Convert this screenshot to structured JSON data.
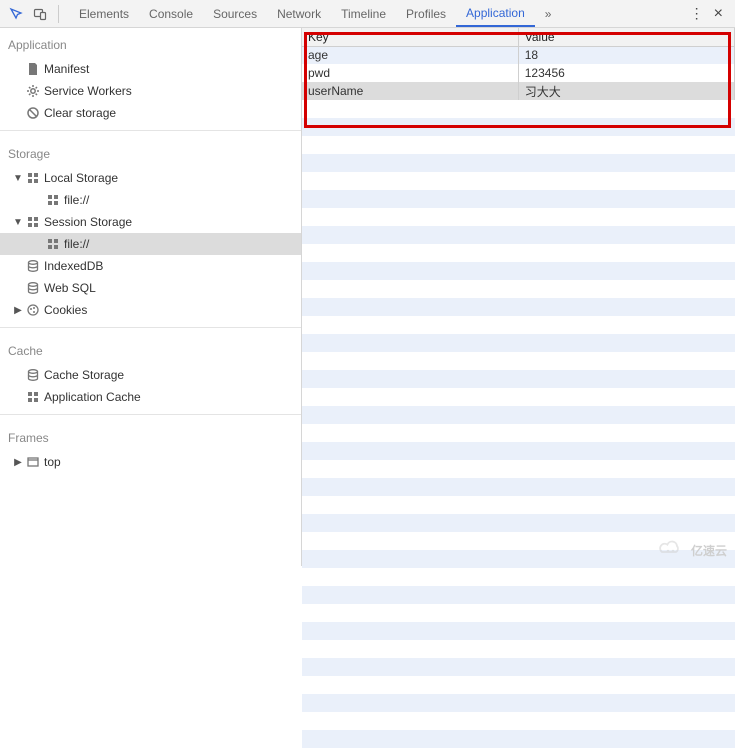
{
  "topbar": {
    "tabs": [
      "Elements",
      "Console",
      "Sources",
      "Network",
      "Timeline",
      "Profiles",
      "Application"
    ],
    "active_tab": "Application",
    "more": "»",
    "menu": "⋮",
    "close": "×"
  },
  "sidebar": {
    "groups": [
      {
        "title": "Application",
        "items": [
          {
            "icon": "manifest-icon",
            "label": "Manifest",
            "level": 1
          },
          {
            "icon": "gear-icon",
            "label": "Service Workers",
            "level": 1
          },
          {
            "icon": "clear-icon",
            "label": "Clear storage",
            "level": 1
          }
        ]
      },
      {
        "title": "Storage",
        "items": [
          {
            "arrow": "▼",
            "icon": "grid-icon",
            "label": "Local Storage",
            "level": 1
          },
          {
            "icon": "grid-icon",
            "label": "file://",
            "level": 2
          },
          {
            "arrow": "▼",
            "icon": "grid-icon",
            "label": "Session Storage",
            "level": 1
          },
          {
            "icon": "grid-icon",
            "label": "file://",
            "level": 2,
            "selected": true
          },
          {
            "icon": "db-icon",
            "label": "IndexedDB",
            "level": 1
          },
          {
            "icon": "db-icon",
            "label": "Web SQL",
            "level": 1
          },
          {
            "arrow": "▶",
            "icon": "cookie-icon",
            "label": "Cookies",
            "level": 1
          }
        ]
      },
      {
        "title": "Cache",
        "items": [
          {
            "icon": "db-icon",
            "label": "Cache Storage",
            "level": 1
          },
          {
            "icon": "grid-icon",
            "label": "Application Cache",
            "level": 1
          }
        ]
      },
      {
        "title": "Frames",
        "items": [
          {
            "arrow": "▶",
            "icon": "frame-icon",
            "label": "top",
            "level": 1
          }
        ]
      }
    ]
  },
  "table": {
    "headers": [
      "Key",
      "Value"
    ],
    "rows": [
      {
        "key": "age",
        "value": "18"
      },
      {
        "key": "pwd",
        "value": "123456"
      },
      {
        "key": "userName",
        "value": "习大大",
        "hl": true
      }
    ]
  },
  "watermark": {
    "text": "亿速云"
  }
}
